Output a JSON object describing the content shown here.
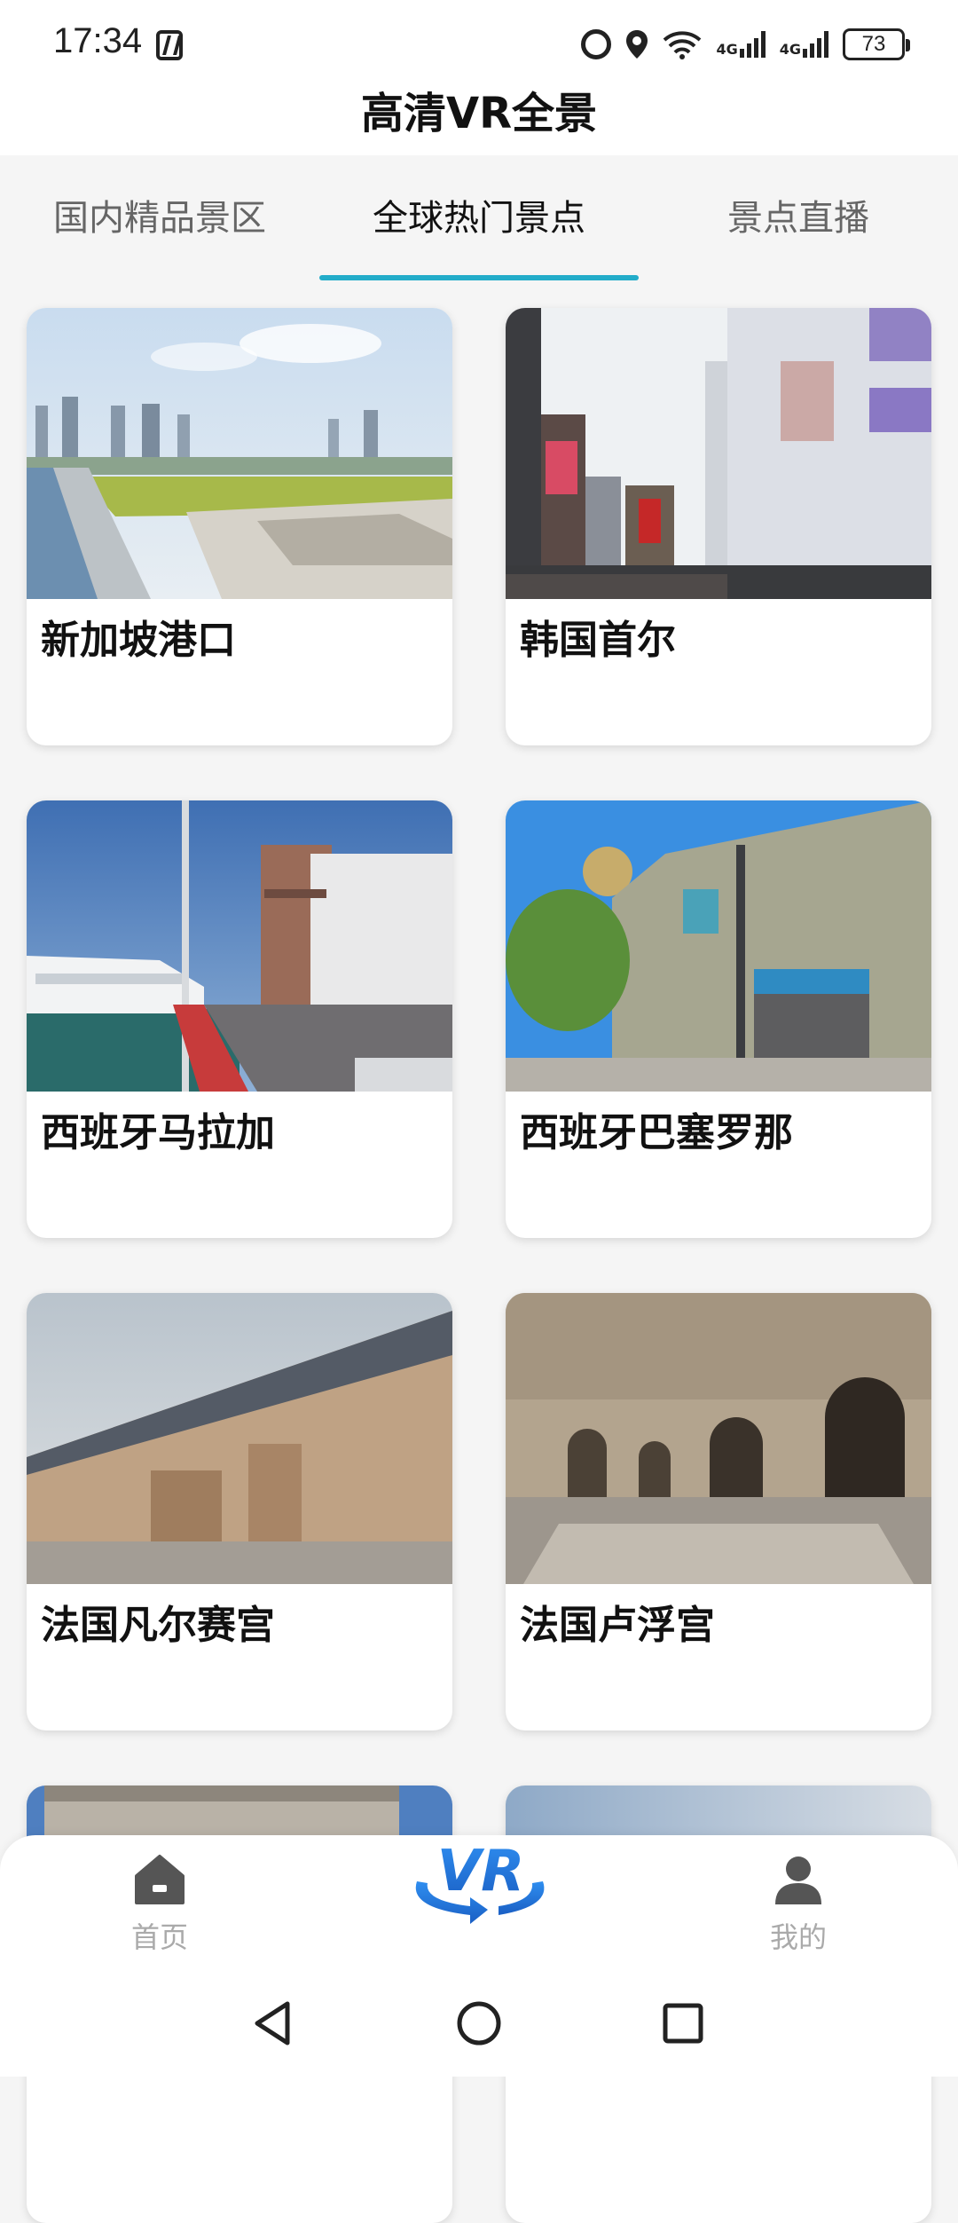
{
  "status_bar": {
    "time": "17:34",
    "net1": "4G",
    "net2": "4G",
    "battery": "73"
  },
  "header": {
    "title": "高清VR全景"
  },
  "tabs": [
    {
      "label": "国内精品景区"
    },
    {
      "label": "全球热门景点"
    },
    {
      "label": "景点直播"
    }
  ],
  "active_tab": 1,
  "cards": [
    {
      "title": "新加坡港口"
    },
    {
      "title": "韩国首尔"
    },
    {
      "title": "西班牙马拉加"
    },
    {
      "title": "西班牙巴塞罗那"
    },
    {
      "title": "法国凡尔赛宫"
    },
    {
      "title": "法国卢浮宫"
    }
  ],
  "bottom_nav": {
    "home_label": "首页",
    "vr_label": "VR",
    "mine_label": "我的"
  },
  "colors": {
    "accent": "#22acc9",
    "vr_blue": "#1f6fd1"
  }
}
